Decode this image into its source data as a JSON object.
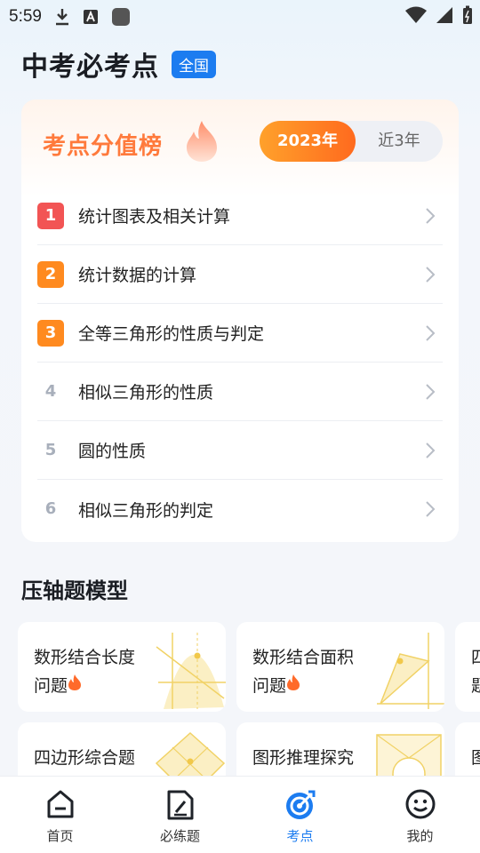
{
  "status_bar": {
    "time": "5:59"
  },
  "header": {
    "title": "中考必考点",
    "region": "全国"
  },
  "ranking": {
    "title": "考点分值榜",
    "year_options": [
      "2023年",
      "近3年"
    ],
    "selected_year": "2023年",
    "items": [
      {
        "rank": "1",
        "label": "统计图表及相关计算"
      },
      {
        "rank": "2",
        "label": "统计数据的计算"
      },
      {
        "rank": "3",
        "label": "全等三角形的性质与判定"
      },
      {
        "rank": "4",
        "label": "相似三角形的性质"
      },
      {
        "rank": "5",
        "label": "圆的性质"
      },
      {
        "rank": "6",
        "label": "相似三角形的判定"
      }
    ]
  },
  "models_section": {
    "title": "压轴题模型",
    "cards": [
      {
        "line1": "数形结合长度",
        "line2": "问题"
      },
      {
        "line1": "数形结合面积",
        "line2": "问题"
      },
      {
        "line1": "四",
        "line2": "题"
      },
      {
        "line1": "四边形综合题",
        "line2": ""
      },
      {
        "line1": "图形推理探究",
        "line2": ""
      },
      {
        "line1": "图",
        "line2": ""
      }
    ]
  },
  "tabbar": {
    "tabs": [
      {
        "label": "首页",
        "icon": "home-icon"
      },
      {
        "label": "必练题",
        "icon": "practice-icon"
      },
      {
        "label": "考点",
        "icon": "target-icon"
      },
      {
        "label": "我的",
        "icon": "smile-icon"
      }
    ],
    "active": "考点"
  },
  "colors": {
    "accent_blue": "#1c7cf0",
    "accent_orange": "#ff7a3c",
    "rank1": "#f25454",
    "rank23": "#ff8a1f"
  }
}
